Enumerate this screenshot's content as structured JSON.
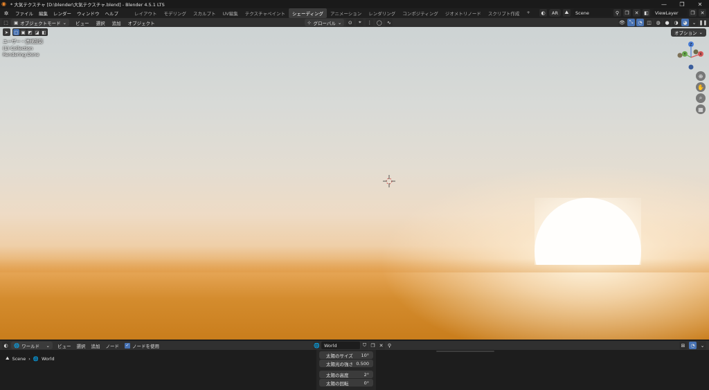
{
  "titlebar": {
    "title": "* 大気テクスチャ [D:\\blender\\大気テクスチャ.blend] - Blender 4.5.1 LTS",
    "minimize": "—",
    "maximize": "❐",
    "close": "✕"
  },
  "menu": [
    "ファイル",
    "編集",
    "レンダー",
    "ウィンドウ",
    "ヘルプ"
  ],
  "workspaces": [
    "レイアウト",
    "モデリング",
    "スカルプト",
    "UV編集",
    "テクスチャペイント",
    "シェーディング",
    "アニメーション",
    "レンダリング",
    "コンポジティング",
    "ジオメトリノード",
    "スクリプト作成"
  ],
  "active_workspace": "シェーディング",
  "add_workspace": "+",
  "topright": {
    "ar_label": "AR",
    "scene": "Scene",
    "view_layer": "ViewLayer"
  },
  "viewport_header": {
    "mode": "オブジェクトモード",
    "menus": [
      "ビュー",
      "選択",
      "追加",
      "オブジェクト"
    ],
    "transform": "グローバル"
  },
  "viewport": {
    "view_name": "ユーザー・透視投影",
    "collection": "(1) Collection",
    "status": "Rendering Done",
    "options": "オプション",
    "gizmo": {
      "x": "X",
      "y": "Y",
      "z": "Z"
    }
  },
  "node_header": {
    "editor": "ワールド",
    "menus": [
      "ビュー",
      "選択",
      "追加",
      "ノード"
    ],
    "use_nodes": "ノードを使用",
    "world_name": "World"
  },
  "breadcrumb": {
    "scene": "Scene",
    "sep": "›",
    "world": "World"
  },
  "sky_panel": [
    {
      "label": "太陽のサイズ",
      "value": "10°"
    },
    {
      "label": "太陽光の強さ",
      "value": "0.500"
    },
    {
      "label": "太陽の高度",
      "value": "2°"
    },
    {
      "label": "太陽の回転",
      "value": "0°"
    }
  ],
  "colors": {
    "accent": "#4772b3",
    "gizmo_x": "#d65a5a",
    "gizmo_y": "#6aa84f",
    "gizmo_z": "#4a7ed8",
    "sun": "#fffefc"
  }
}
